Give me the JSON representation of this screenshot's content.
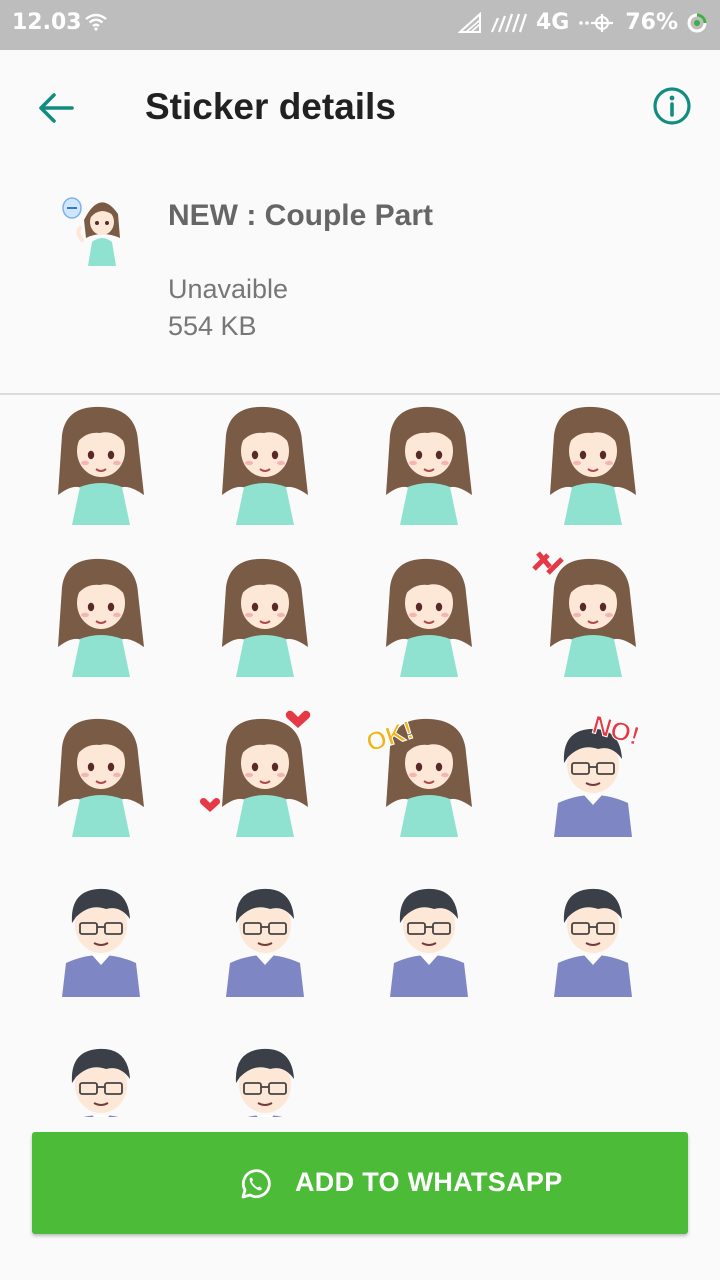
{
  "status_bar": {
    "time": "12.03",
    "network": "4G",
    "battery": "76%"
  },
  "toolbar": {
    "title": "Sticker details",
    "back_icon": "arrow-back-icon",
    "info_icon": "info-icon",
    "accent_color": "#128c7e"
  },
  "pack": {
    "name": "NEW : Couple Part",
    "status": "Unavaible",
    "size": "554 KB"
  },
  "stickers": [
    {
      "name": "girl-cheering-pompoms"
    },
    {
      "name": "girl-waving-happy"
    },
    {
      "name": "girl-bowing-sad"
    },
    {
      "name": "girl-leaning-desk"
    },
    {
      "name": "girl-surprised"
    },
    {
      "name": "girl-sitting-blush"
    },
    {
      "name": "girl-sitting-smile"
    },
    {
      "name": "girl-angry"
    },
    {
      "name": "girl-confused"
    },
    {
      "name": "girl-hearts-love"
    },
    {
      "name": "girl-ok-sign",
      "text": "OK!"
    },
    {
      "name": "boy-no-sign",
      "text": "NO!"
    },
    {
      "name": "boy-surprised"
    },
    {
      "name": "boy-thinking"
    },
    {
      "name": "boy-gloomy"
    },
    {
      "name": "boy-arms-crossed"
    },
    {
      "name": "boy-frustrated"
    },
    {
      "name": "boy-embarrassed"
    }
  ],
  "add_button": {
    "label": "ADD TO WHATSAPP",
    "icon": "whatsapp-icon",
    "color": "#4cbb38"
  }
}
